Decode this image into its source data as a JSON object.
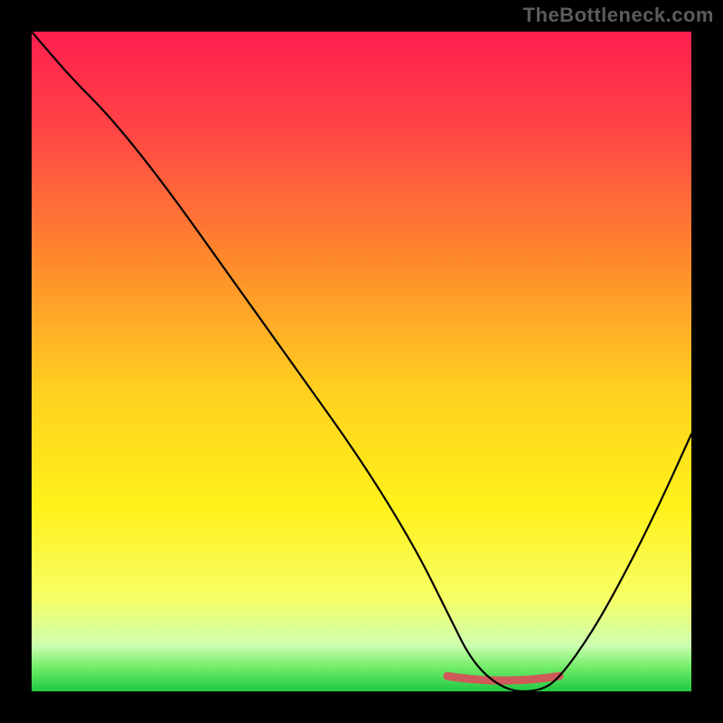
{
  "watermark": "TheBottleneck.com",
  "chart_data": {
    "type": "line",
    "title": "",
    "xlabel": "",
    "ylabel": "",
    "xlim": [
      0,
      100
    ],
    "ylim": [
      0,
      100
    ],
    "grid": false,
    "legend": false,
    "gradient_stops": [
      {
        "offset": 0.0,
        "color": "#ff1f4f"
      },
      {
        "offset": 0.15,
        "color": "#ff4545"
      },
      {
        "offset": 0.35,
        "color": "#ff8b2c"
      },
      {
        "offset": 0.55,
        "color": "#ffd21f"
      },
      {
        "offset": 0.72,
        "color": "#fff11a"
      },
      {
        "offset": 0.86,
        "color": "#f6ff66"
      },
      {
        "offset": 0.93,
        "color": "#cdffb0"
      },
      {
        "offset": 0.965,
        "color": "#6eec66"
      },
      {
        "offset": 1.0,
        "color": "#20c943"
      }
    ],
    "series": [
      {
        "name": "bottleneck-curve",
        "x": [
          0,
          6,
          12,
          20,
          30,
          40,
          50,
          58,
          63,
          67,
          72,
          77,
          80,
          85,
          90,
          95,
          100
        ],
        "y": [
          100,
          93,
          87,
          77,
          63,
          49,
          35,
          22,
          12,
          4,
          0,
          0,
          2,
          9,
          18,
          28,
          39
        ]
      }
    ],
    "valley_marker": {
      "comment": "approximate pink highlight span at the valley floor",
      "x_start": 63,
      "x_end": 80,
      "y": 1.5
    }
  }
}
